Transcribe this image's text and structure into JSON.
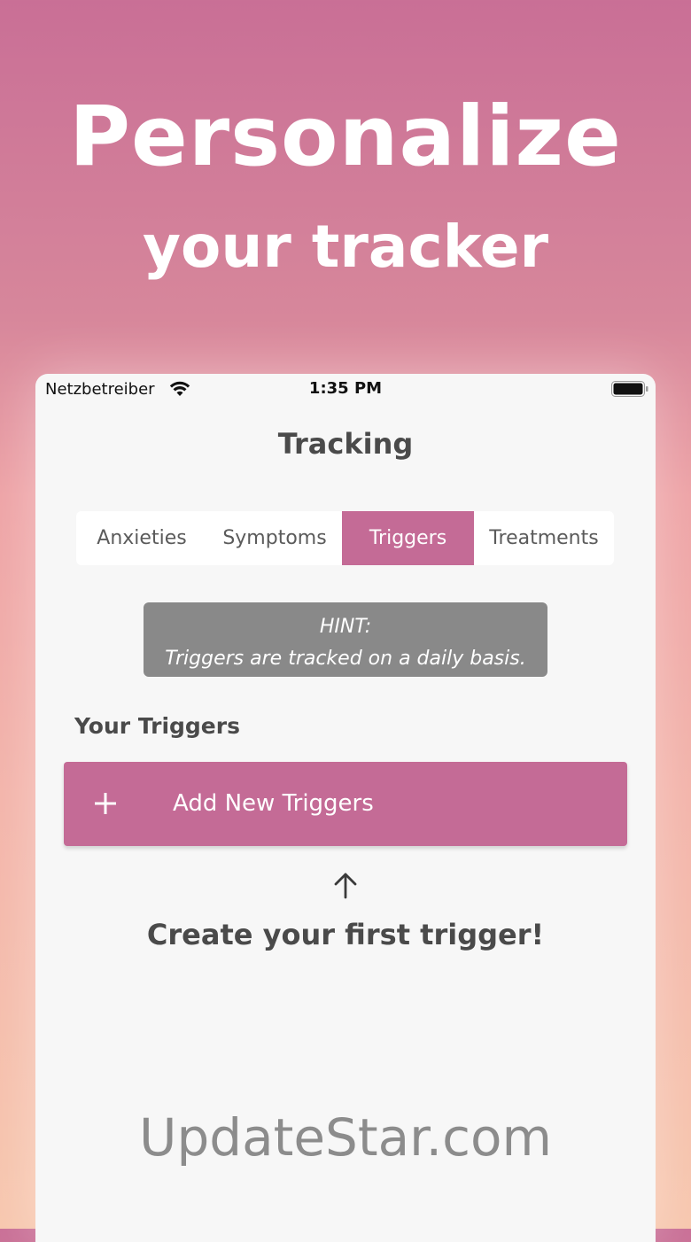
{
  "hero": {
    "title": "Personalize",
    "subtitle": "your tracker"
  },
  "status_bar": {
    "carrier": "Netzbetreiber",
    "time": "1:35 PM",
    "icons": [
      "wifi-icon",
      "battery-icon"
    ]
  },
  "screen": {
    "title": "Tracking",
    "tabs": [
      {
        "label": "Anxieties",
        "active": false
      },
      {
        "label": "Symptoms",
        "active": false
      },
      {
        "label": "Triggers",
        "active": true
      },
      {
        "label": "Treatments",
        "active": false
      }
    ],
    "hint": {
      "heading": "HINT:",
      "text": "Triggers are tracked on a daily basis."
    },
    "section_label": "Your Triggers",
    "add_button": {
      "icon": "plus-icon",
      "label": "Add New Triggers"
    },
    "arrow_icon": "arrow-up-icon",
    "empty_state": "Create your first trigger!"
  },
  "watermark": "UpdateStar.com",
  "colors": {
    "accent": "#c46b96",
    "hint_background": "#898989",
    "screen_background": "#f7f7f7",
    "text_dark": "#4a4a4a"
  }
}
